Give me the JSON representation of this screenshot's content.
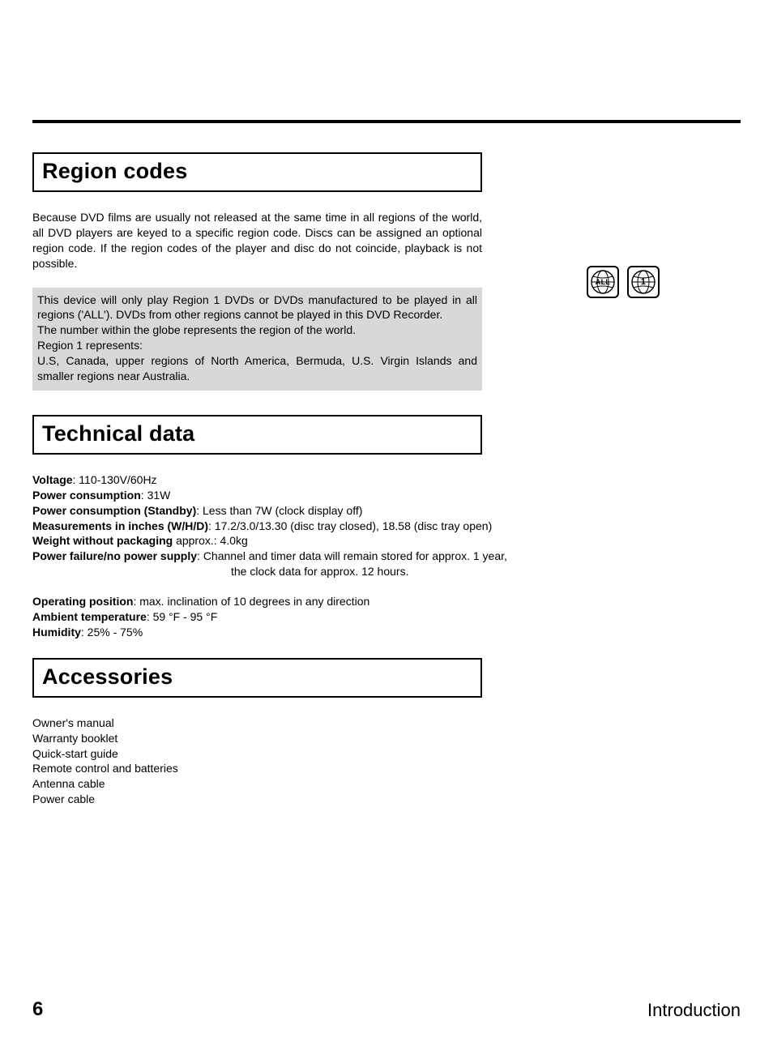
{
  "sections": {
    "region": {
      "title": "Region codes",
      "intro": "Because DVD films are usually not released at the same time in all regions of the world, all DVD players are keyed to a specific region code. Discs can be assigned an optional region code. If the region codes of the player and disc do not coincide, playback is not possible.",
      "gray_line1": "This device will only play Region 1 DVDs or DVDs manufactured to be played in all regions ('ALL'). DVDs from other regions cannot be played in this DVD Recorder.",
      "gray_line2": "The number within the globe represents the region of the world.",
      "gray_line3": "Region 1 represents:",
      "gray_line4": "U.S, Canada, upper regions of North America, Bermuda, U.S. Virgin Islands and smaller regions near Australia."
    },
    "tech": {
      "title": "Technical data",
      "specs": [
        {
          "label": "Voltage",
          "value": ": 110-130V/60Hz"
        },
        {
          "label": "Power consumption",
          "value": ": 31W"
        },
        {
          "label": "Power consumption (Standby)",
          "value": ": Less than 7W (clock display off)"
        },
        {
          "label": "Measurements in inches (W/H/D)",
          "value": ": 17.2/3.0/13.30 (disc tray closed), 18.58 (disc tray open)"
        },
        {
          "label": "Weight without packaging",
          "value": " approx.: 4.0kg"
        },
        {
          "label": "Power failure/no power supply",
          "value": ":  Channel and timer data will remain stored for approx. 1 year,"
        }
      ],
      "powerfail_cont": "the clock data for approx. 12 hours.",
      "specs2": [
        {
          "label": "Operating position",
          "value": ": max. inclination of 10 degrees in any direction"
        },
        {
          "label": "Ambient temperature",
          "value": ": 59 °F - 95 °F"
        },
        {
          "label": "Humidity",
          "value": ": 25% - 75%"
        }
      ]
    },
    "acc": {
      "title": "Accessories",
      "items": [
        "Owner's manual",
        "Warranty booklet",
        "Quick-start guide",
        "Remote control and batteries",
        "Antenna cable",
        "Power cable"
      ]
    }
  },
  "globes": {
    "all_label": "ALL",
    "one_label": "1"
  },
  "footer": {
    "page": "6",
    "chapter": "Introduction"
  }
}
